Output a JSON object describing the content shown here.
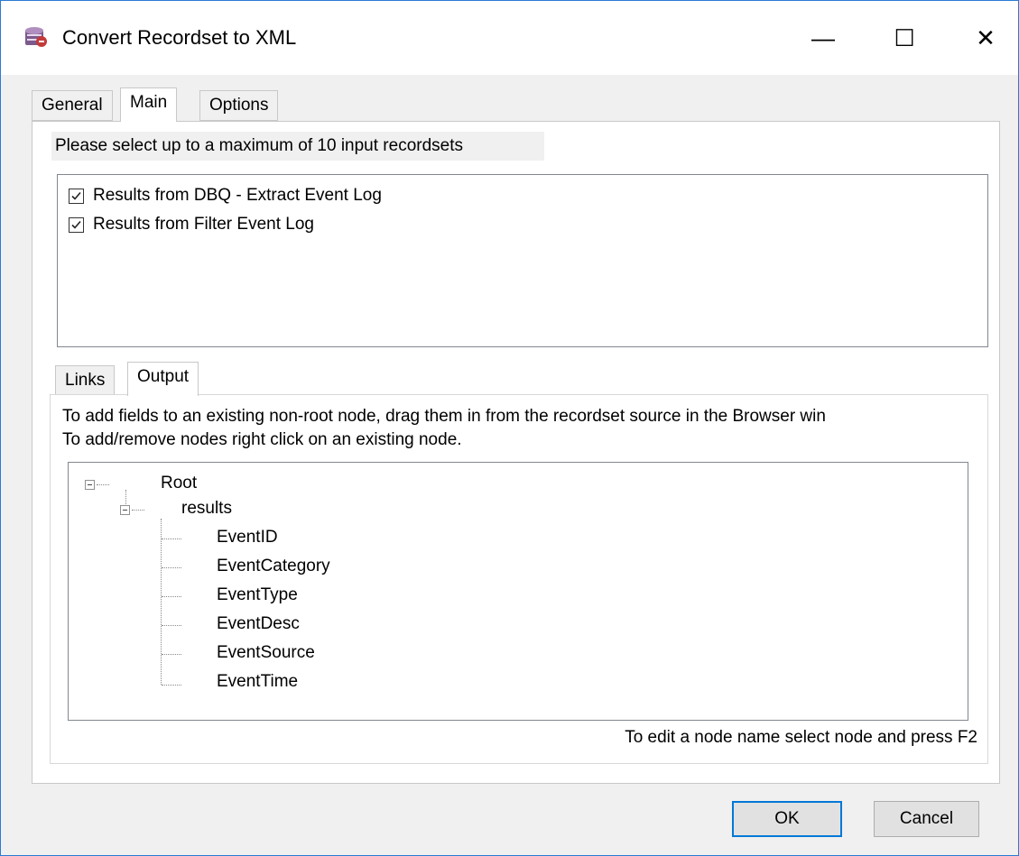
{
  "window": {
    "title": "Convert Recordset to XML",
    "app_icon": "database-xml-icon",
    "controls": {
      "minimize": "—",
      "maximize": "☐",
      "close": "✕"
    }
  },
  "tabs": [
    {
      "label": "General",
      "active": false
    },
    {
      "label": "Main",
      "active": true
    },
    {
      "label": "Options",
      "active": false
    }
  ],
  "main": {
    "hint": "Please select up to a maximum of 10 input recordsets",
    "recordsets": [
      {
        "label": "Results from DBQ - Extract Event Log",
        "checked": true
      },
      {
        "label": "Results from Filter Event Log",
        "checked": true
      }
    ]
  },
  "subtabs": [
    {
      "label": "Links",
      "active": false
    },
    {
      "label": "Output",
      "active": true
    }
  ],
  "output": {
    "info_line_1": "To add fields to an existing non-root node, drag them in from the recordset source in the Browser win",
    "info_line_2": "To add/remove nodes right click on an existing node.",
    "tree": {
      "root": "Root",
      "child": "results",
      "fields": [
        "EventID",
        "EventCategory",
        "EventType",
        "EventDesc",
        "EventSource",
        "EventTime"
      ]
    },
    "footer_note": "To edit a node name select node and press F2"
  },
  "buttons": {
    "ok": "OK",
    "cancel": "Cancel"
  },
  "colors": {
    "focus_border": "#0078d7",
    "window_border": "#2b7bd4",
    "dialog_bg": "#f0f0f0"
  }
}
